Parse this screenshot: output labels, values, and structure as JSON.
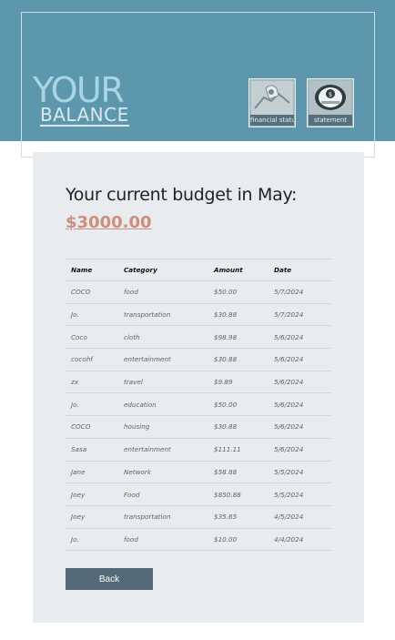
{
  "header": {
    "logo_top": "YOUR",
    "logo_bottom": "BALANCE",
    "nav": [
      {
        "label": "financial status",
        "icon": "handshake-icon"
      },
      {
        "label": "statement",
        "icon": "money-bag-icon"
      }
    ]
  },
  "budget": {
    "title": "Your current budget in May:",
    "amount": "$3000.00"
  },
  "table": {
    "headers": [
      "Name",
      "Category",
      "Amount",
      "Date"
    ],
    "rows": [
      [
        "COCO",
        "food",
        "$50.00",
        "5/7/2024"
      ],
      [
        "Jo.",
        "transportation",
        "$30.88",
        "5/7/2024"
      ],
      [
        "Coco",
        "cloth",
        "$98.98",
        "5/6/2024"
      ],
      [
        "cocohf",
        "entertainment",
        "$30.88",
        "5/6/2024"
      ],
      [
        "zx",
        "travel",
        "$9.89",
        "5/6/2024"
      ],
      [
        "Jo.",
        "education",
        "$50.00",
        "5/6/2024"
      ],
      [
        "COCO",
        "housing",
        "$30.88",
        "5/6/2024"
      ],
      [
        "Sasa",
        "entertainment",
        "$111.11",
        "5/6/2024"
      ],
      [
        "Jane",
        "Network",
        "$58.88",
        "5/5/2024"
      ],
      [
        "Joey",
        "Food",
        "$850.88",
        "5/5/2024"
      ],
      [
        "Joey",
        "transportation",
        "$35.65",
        "4/5/2024"
      ],
      [
        "Jo.",
        "food",
        "$10.00",
        "4/4/2024"
      ]
    ]
  },
  "actions": {
    "back_label": "Back"
  },
  "colors": {
    "header_bg": "#5c97ae",
    "card_bg": "#e8ecee",
    "amount": "#cc8f7d",
    "button_bg": "#536a76"
  }
}
